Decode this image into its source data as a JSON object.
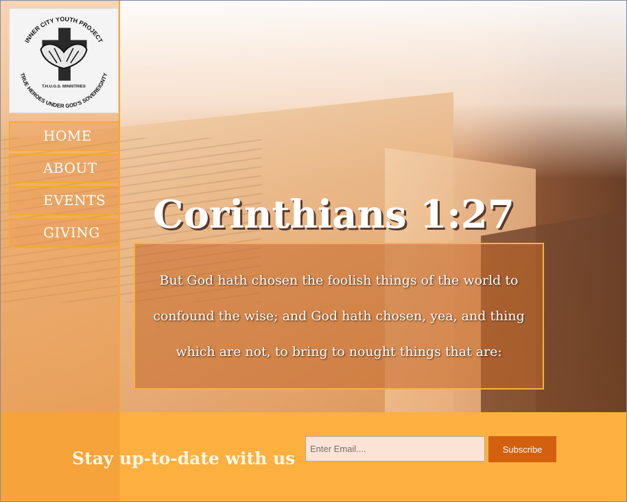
{
  "logo": {
    "top_text": "INNER CITY YOUTH PROJECT",
    "middle_text": "T.H.U.G.S. MINISTRIES",
    "bottom_text": "TRUE HEROES UNDER GOD'S SOVEREIGNTY"
  },
  "nav": {
    "items": [
      {
        "label": "HOME"
      },
      {
        "label": "ABOUT"
      },
      {
        "label": "EVENTS"
      },
      {
        "label": "GIVING"
      }
    ]
  },
  "hero": {
    "heading": "Corinthians 1:27",
    "verse": "But God hath chosen the foolish things of the world to confound the wise; and God hath chosen, yea, and thing which are not, to bring to nought things that are:"
  },
  "newsletter": {
    "title": "Stay up-to-date with us",
    "email_placeholder": "Enter Email....",
    "subscribe_label": "Subscribe"
  },
  "colors": {
    "accent": "#fbb040",
    "button": "#d2600f",
    "verse_box": "#c46828"
  }
}
